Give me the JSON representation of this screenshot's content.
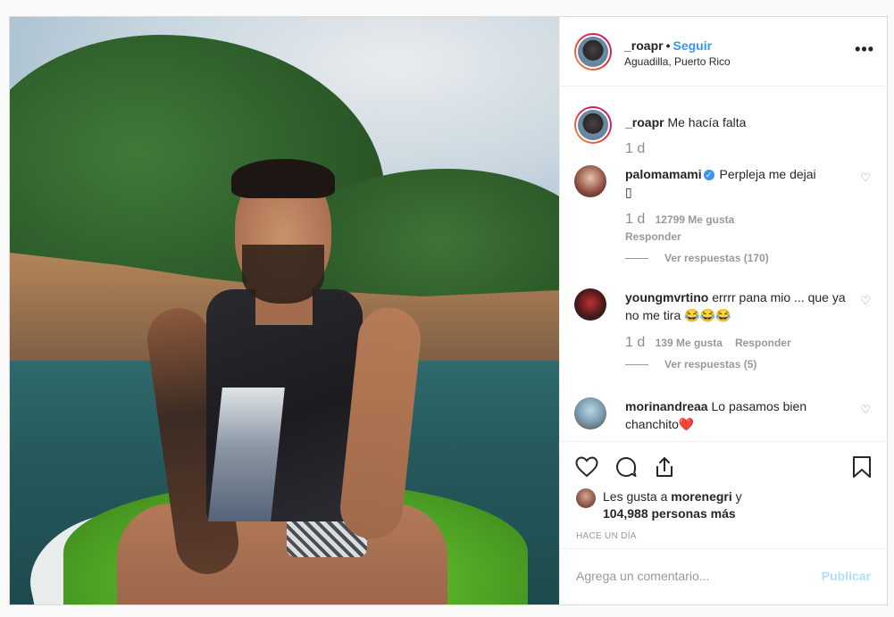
{
  "post": {
    "username": "_roapr",
    "follow_label": "Seguir",
    "location": "Aguadilla, Puerto Rico",
    "more_label": "•••"
  },
  "caption": {
    "username": "_roapr",
    "text": "Me hacía falta",
    "time": "1 d"
  },
  "comments": [
    {
      "username": "palomamami",
      "verified": true,
      "text": "Perpleja me dejai",
      "emoji_line": "▯",
      "time": "1 d",
      "likes": "12799 Me gusta",
      "reply_label": "Responder",
      "view_replies": "Ver respuestas (170)"
    },
    {
      "username": "youngmvrtino",
      "text": "errrr pana mio ... que ya no me tira 😂😂😂",
      "time": "1 d",
      "likes": "139 Me gusta",
      "reply_label": "Responder",
      "view_replies": "Ver respuestas (5)"
    },
    {
      "username": "morinandreaa",
      "text": "Lo pasamos bien chanchito❤️"
    }
  ],
  "likes": {
    "prefix": "Les gusta a",
    "user": "morenegri",
    "conj": "y",
    "others": "104,988 personas más"
  },
  "time_ago": "HACE UN DÍA",
  "comment_box": {
    "placeholder": "Agrega un comentario...",
    "publish": "Publicar"
  },
  "colors": {
    "accent": "#3897f0",
    "publish_disabled": "#b2dffc",
    "heart_red": "#ed4956"
  },
  "icons": [
    "heart-icon",
    "comment-icon",
    "share-icon",
    "bookmark-icon",
    "more-icon"
  ]
}
